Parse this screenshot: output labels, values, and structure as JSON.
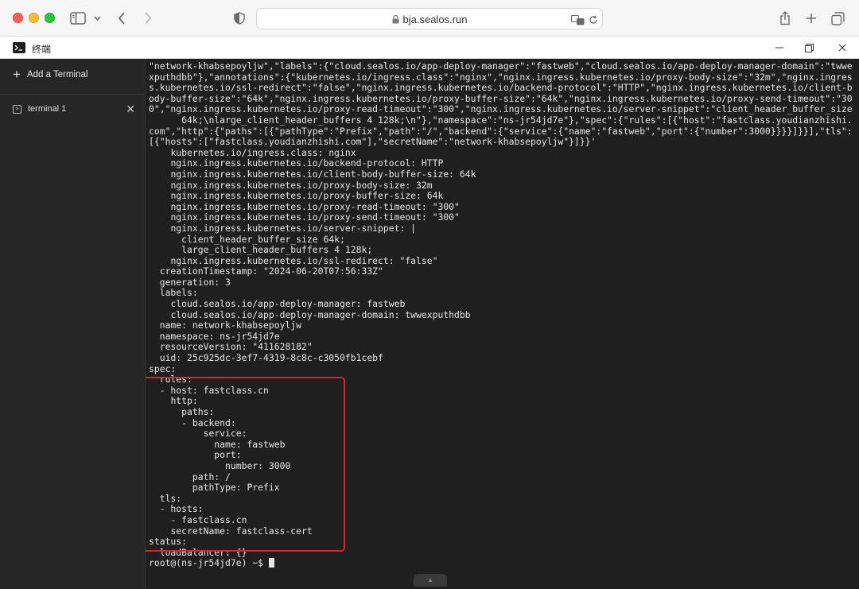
{
  "browser": {
    "url": "bja.sealos.run"
  },
  "app": {
    "title": "终端"
  },
  "sidebar": {
    "add_label": "Add a Terminal",
    "terminals": [
      {
        "label": "terminal 1"
      }
    ]
  },
  "terminal": {
    "lines": [
      "\"network-khabsepoyljw\",\"labels\":{\"cloud.sealos.io/app-deploy-manager\":\"fastweb\",\"cloud.sealos.io/app-deploy-manager-domain\":\"twwexputhdbb\"},\"annotations\":{\"kubernetes.io/ingress.class\":\"nginx\",\"nginx.ingress.kubernetes.io/proxy-body-size\":\"32m\",\"nginx.ingress.kubernetes.io/ssl-redirect\":\"false\",\"nginx.ingress.kubernetes.io/backend-protocol\":\"HTTP\",\"nginx.ingress.kubernetes.io/client-body-buffer-size\":\"64k\",\"nginx.ingress.kubernetes.io/proxy-buffer-size\":\"64k\",\"nginx.ingress.kubernetes.io/proxy-send-timeout\":\"300\",\"nginx.ingress.kubernetes.io/proxy-read-timeout\":\"300\",\"nginx.ingress.kubernetes.io/server-snippet\":\"client_header_buffer_size",
      "      64k;\\nlarge_client_header_buffers 4 128k;\\n\"},\"namespace\":\"ns-jr54jd7e\"},\"spec\":{\"rules\":[{\"host\":\"fastclass.youdianzhishi.com\",\"http\":{\"paths\":[{\"pathType\":\"Prefix\",\"path\":\"/\",\"backend\":{\"service\":{\"name\":\"fastweb\",\"port\":{\"number\":3000}}}}]}}],\"tls\":[{\"hosts\":[\"fastclass.youdianzhishi.com\"],\"secretName\":\"network-khabsepoyljw\"}]}}'",
      "    kubernetes.io/ingress.class: nginx",
      "    nginx.ingress.kubernetes.io/backend-protocol: HTTP",
      "    nginx.ingress.kubernetes.io/client-body-buffer-size: 64k",
      "    nginx.ingress.kubernetes.io/proxy-body-size: 32m",
      "    nginx.ingress.kubernetes.io/proxy-buffer-size: 64k",
      "    nginx.ingress.kubernetes.io/proxy-read-timeout: \"300\"",
      "    nginx.ingress.kubernetes.io/proxy-send-timeout: \"300\"",
      "    nginx.ingress.kubernetes.io/server-snippet: |",
      "      client_header_buffer_size 64k;",
      "      large_client_header_buffers 4 128k;",
      "    nginx.ingress.kubernetes.io/ssl-redirect: \"false\"",
      "  creationTimestamp: \"2024-06-20T07:56:33Z\"",
      "  generation: 3",
      "  labels:",
      "    cloud.sealos.io/app-deploy-manager: fastweb",
      "    cloud.sealos.io/app-deploy-manager-domain: twwexputhdbb",
      "  name: network-khabsepoyljw",
      "  namespace: ns-jr54jd7e",
      "  resourceVersion: \"411628182\"",
      "  uid: 25c925dc-3ef7-4319-8c8c-c3050fb1cebf",
      "spec:",
      "  rules:",
      "  - host: fastclass.cn",
      "    http:",
      "      paths:",
      "      - backend:",
      "          service:",
      "            name: fastweb",
      "            port:",
      "              number: 3000",
      "        path: /",
      "        pathType: Prefix",
      "  tls:",
      "  - hosts:",
      "    - fastclass.cn",
      "    secretName: fastclass-cert",
      "status:",
      "  loadBalancer: {}",
      "root@(ns-jr54jd7e) ~$ "
    ]
  }
}
